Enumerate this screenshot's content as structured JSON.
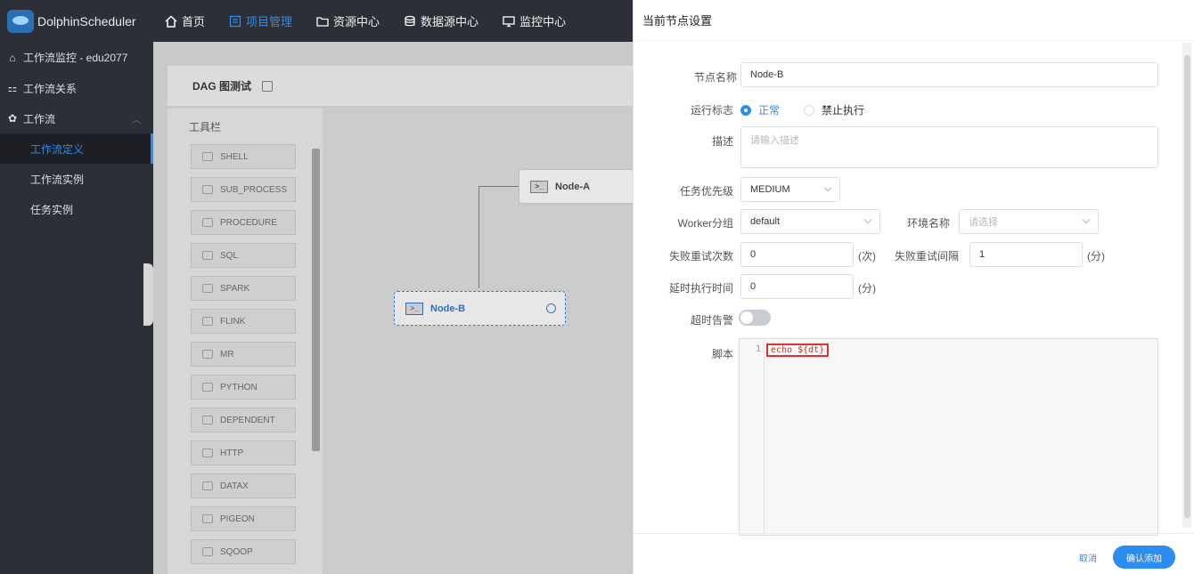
{
  "app": {
    "name": "DolphinScheduler"
  },
  "nav": [
    {
      "label": "首页",
      "icon": "home-icon",
      "active": false
    },
    {
      "label": "项目管理",
      "icon": "project-icon",
      "active": true
    },
    {
      "label": "资源中心",
      "icon": "folder-icon",
      "active": false
    },
    {
      "label": "数据源中心",
      "icon": "database-icon",
      "active": false
    },
    {
      "label": "监控中心",
      "icon": "monitor-icon",
      "active": false
    }
  ],
  "sidebar": {
    "header": "工作流监控 - edu2077",
    "items": [
      {
        "label": "工作流关系"
      },
      {
        "label": "工作流"
      },
      {
        "label": "工作流定义"
      },
      {
        "label": "工作流实例"
      },
      {
        "label": "任务实例"
      }
    ]
  },
  "dag": {
    "title": "DAG 图测试",
    "toolbar_title": "工具栏",
    "tools": [
      "SHELL",
      "SUB_PROCESS",
      "PROCEDURE",
      "SQL",
      "SPARK",
      "FLINK",
      "MR",
      "PYTHON",
      "DEPENDENT",
      "HTTP",
      "DATAX",
      "PIGEON",
      "SQOOP"
    ],
    "nodes": [
      {
        "name": "Node-A"
      },
      {
        "name": "Node-B"
      }
    ]
  },
  "drawer": {
    "title": "当前节点设置",
    "fields": {
      "node_name": {
        "label": "节点名称",
        "value": "Node-B"
      },
      "run_flag": {
        "label": "运行标志",
        "options": [
          "正常",
          "禁止执行"
        ],
        "selected": "正常"
      },
      "description": {
        "label": "描述",
        "placeholder": "请输入描述"
      },
      "priority": {
        "label": "任务优先级",
        "value": "MEDIUM"
      },
      "worker_group": {
        "label": "Worker分组",
        "value": "default"
      },
      "environment": {
        "label": "环境名称",
        "placeholder": "请选择"
      },
      "retry_times": {
        "label": "失败重试次数",
        "value": "0",
        "unit": "(次)"
      },
      "retry_interval": {
        "label": "失败重试间隔",
        "value": "1",
        "unit": "(分)"
      },
      "delay_time": {
        "label": "延时执行时间",
        "value": "0",
        "unit": "(分)"
      },
      "timeout_alert": {
        "label": "超时告警",
        "enabled": false
      },
      "script": {
        "label": "脚本",
        "line_number": "1",
        "code": "echo ${dt}"
      }
    },
    "buttons": {
      "cancel": "取消",
      "confirm": "确认添加"
    }
  },
  "colors": {
    "accent": "#2d8cf0",
    "header_bg": "#2c2f36",
    "highlight": "#e03131"
  }
}
